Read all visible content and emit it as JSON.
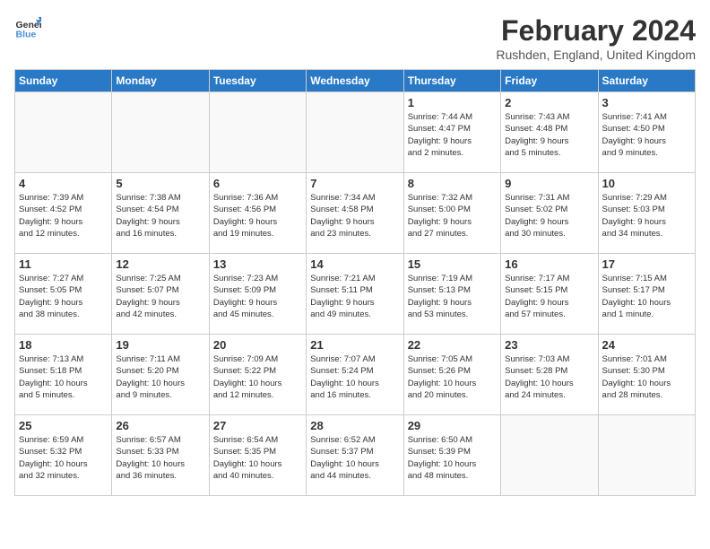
{
  "logo": {
    "line1": "General",
    "line2": "Blue"
  },
  "title": "February 2024",
  "location": "Rushden, England, United Kingdom",
  "days_of_week": [
    "Sunday",
    "Monday",
    "Tuesday",
    "Wednesday",
    "Thursday",
    "Friday",
    "Saturday"
  ],
  "weeks": [
    [
      {
        "num": "",
        "info": ""
      },
      {
        "num": "",
        "info": ""
      },
      {
        "num": "",
        "info": ""
      },
      {
        "num": "",
        "info": ""
      },
      {
        "num": "1",
        "info": "Sunrise: 7:44 AM\nSunset: 4:47 PM\nDaylight: 9 hours\nand 2 minutes."
      },
      {
        "num": "2",
        "info": "Sunrise: 7:43 AM\nSunset: 4:48 PM\nDaylight: 9 hours\nand 5 minutes."
      },
      {
        "num": "3",
        "info": "Sunrise: 7:41 AM\nSunset: 4:50 PM\nDaylight: 9 hours\nand 9 minutes."
      }
    ],
    [
      {
        "num": "4",
        "info": "Sunrise: 7:39 AM\nSunset: 4:52 PM\nDaylight: 9 hours\nand 12 minutes."
      },
      {
        "num": "5",
        "info": "Sunrise: 7:38 AM\nSunset: 4:54 PM\nDaylight: 9 hours\nand 16 minutes."
      },
      {
        "num": "6",
        "info": "Sunrise: 7:36 AM\nSunset: 4:56 PM\nDaylight: 9 hours\nand 19 minutes."
      },
      {
        "num": "7",
        "info": "Sunrise: 7:34 AM\nSunset: 4:58 PM\nDaylight: 9 hours\nand 23 minutes."
      },
      {
        "num": "8",
        "info": "Sunrise: 7:32 AM\nSunset: 5:00 PM\nDaylight: 9 hours\nand 27 minutes."
      },
      {
        "num": "9",
        "info": "Sunrise: 7:31 AM\nSunset: 5:02 PM\nDaylight: 9 hours\nand 30 minutes."
      },
      {
        "num": "10",
        "info": "Sunrise: 7:29 AM\nSunset: 5:03 PM\nDaylight: 9 hours\nand 34 minutes."
      }
    ],
    [
      {
        "num": "11",
        "info": "Sunrise: 7:27 AM\nSunset: 5:05 PM\nDaylight: 9 hours\nand 38 minutes."
      },
      {
        "num": "12",
        "info": "Sunrise: 7:25 AM\nSunset: 5:07 PM\nDaylight: 9 hours\nand 42 minutes."
      },
      {
        "num": "13",
        "info": "Sunrise: 7:23 AM\nSunset: 5:09 PM\nDaylight: 9 hours\nand 45 minutes."
      },
      {
        "num": "14",
        "info": "Sunrise: 7:21 AM\nSunset: 5:11 PM\nDaylight: 9 hours\nand 49 minutes."
      },
      {
        "num": "15",
        "info": "Sunrise: 7:19 AM\nSunset: 5:13 PM\nDaylight: 9 hours\nand 53 minutes."
      },
      {
        "num": "16",
        "info": "Sunrise: 7:17 AM\nSunset: 5:15 PM\nDaylight: 9 hours\nand 57 minutes."
      },
      {
        "num": "17",
        "info": "Sunrise: 7:15 AM\nSunset: 5:17 PM\nDaylight: 10 hours\nand 1 minute."
      }
    ],
    [
      {
        "num": "18",
        "info": "Sunrise: 7:13 AM\nSunset: 5:18 PM\nDaylight: 10 hours\nand 5 minutes."
      },
      {
        "num": "19",
        "info": "Sunrise: 7:11 AM\nSunset: 5:20 PM\nDaylight: 10 hours\nand 9 minutes."
      },
      {
        "num": "20",
        "info": "Sunrise: 7:09 AM\nSunset: 5:22 PM\nDaylight: 10 hours\nand 12 minutes."
      },
      {
        "num": "21",
        "info": "Sunrise: 7:07 AM\nSunset: 5:24 PM\nDaylight: 10 hours\nand 16 minutes."
      },
      {
        "num": "22",
        "info": "Sunrise: 7:05 AM\nSunset: 5:26 PM\nDaylight: 10 hours\nand 20 minutes."
      },
      {
        "num": "23",
        "info": "Sunrise: 7:03 AM\nSunset: 5:28 PM\nDaylight: 10 hours\nand 24 minutes."
      },
      {
        "num": "24",
        "info": "Sunrise: 7:01 AM\nSunset: 5:30 PM\nDaylight: 10 hours\nand 28 minutes."
      }
    ],
    [
      {
        "num": "25",
        "info": "Sunrise: 6:59 AM\nSunset: 5:32 PM\nDaylight: 10 hours\nand 32 minutes."
      },
      {
        "num": "26",
        "info": "Sunrise: 6:57 AM\nSunset: 5:33 PM\nDaylight: 10 hours\nand 36 minutes."
      },
      {
        "num": "27",
        "info": "Sunrise: 6:54 AM\nSunset: 5:35 PM\nDaylight: 10 hours\nand 40 minutes."
      },
      {
        "num": "28",
        "info": "Sunrise: 6:52 AM\nSunset: 5:37 PM\nDaylight: 10 hours\nand 44 minutes."
      },
      {
        "num": "29",
        "info": "Sunrise: 6:50 AM\nSunset: 5:39 PM\nDaylight: 10 hours\nand 48 minutes."
      },
      {
        "num": "",
        "info": ""
      },
      {
        "num": "",
        "info": ""
      }
    ]
  ]
}
